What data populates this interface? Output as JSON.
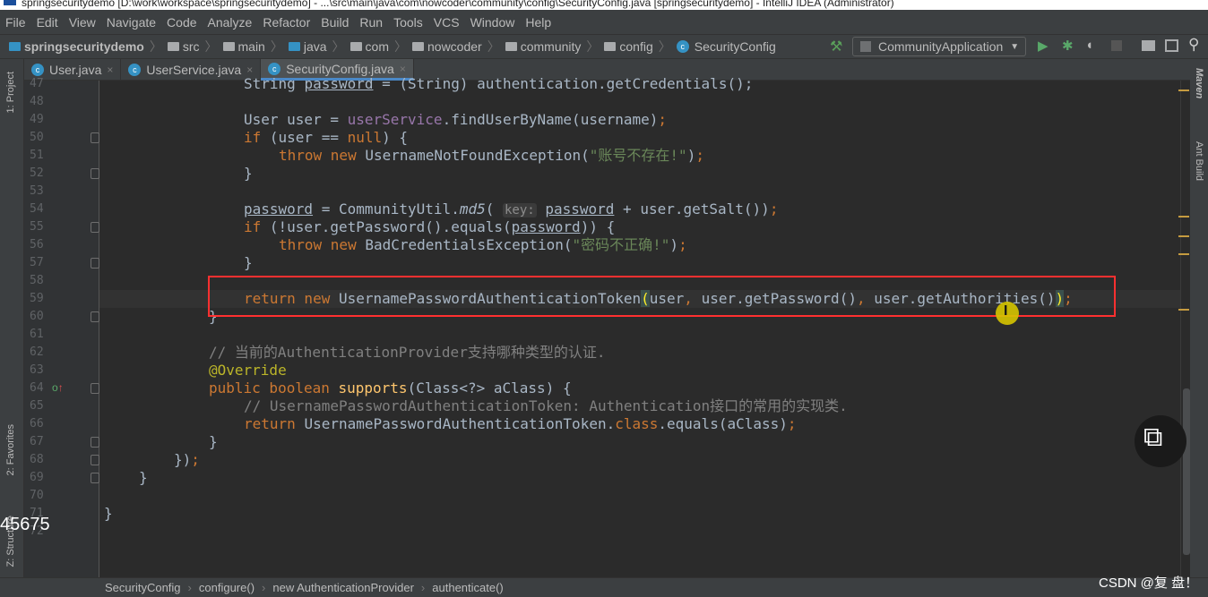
{
  "window": {
    "title": "springsecuritydemo [D:\\work\\workspace\\springsecuritydemo] - ...\\src\\main\\java\\com\\nowcoder\\community\\config\\SecurityConfig.java [springsecuritydemo] - IntelliJ IDEA (Administrator)"
  },
  "menu": [
    "File",
    "Edit",
    "View",
    "Navigate",
    "Code",
    "Analyze",
    "Refactor",
    "Build",
    "Run",
    "Tools",
    "VCS",
    "Window",
    "Help"
  ],
  "breadcrumb": [
    "springsecuritydemo",
    "src",
    "main",
    "java",
    "com",
    "nowcoder",
    "community",
    "config",
    "SecurityConfig"
  ],
  "toolbar": {
    "run_config": "CommunityApplication"
  },
  "tabs": [
    {
      "label": "User.java",
      "active": false
    },
    {
      "label": "UserService.java",
      "active": false
    },
    {
      "label": "SecurityConfig.java",
      "active": true
    }
  ],
  "left_tools": {
    "project": "1: Project",
    "favorites": "2: Favorites",
    "structure": "Z: Structure"
  },
  "right_tools": {
    "maven": "Maven",
    "ant": "Ant Build"
  },
  "code": [
    {
      "n": 47,
      "indent": 4,
      "tokens": [
        [
          "String ",
          ""
        ],
        [
          "password",
          "t-ul"
        ],
        [
          " = (String) authentication.getCredentials();",
          ""
        ]
      ]
    },
    {
      "n": 48,
      "indent": 0,
      "tokens": []
    },
    {
      "n": 49,
      "indent": 4,
      "tokens": [
        [
          "User user = ",
          ""
        ],
        [
          "userService",
          "t-field"
        ],
        [
          ".findUserByName(username)",
          ""
        ],
        [
          ";",
          "t-kw"
        ]
      ]
    },
    {
      "n": 50,
      "indent": 4,
      "tokens": [
        [
          "if",
          "t-kw"
        ],
        [
          " (user == ",
          ""
        ],
        [
          "null",
          "t-kw"
        ],
        [
          ") {",
          ""
        ]
      ],
      "fold": true
    },
    {
      "n": 51,
      "indent": 5,
      "tokens": [
        [
          "throw new ",
          "t-kw"
        ],
        [
          "UsernameNotFoundException(",
          ""
        ],
        [
          "\"账号不存在!\"",
          "t-str"
        ],
        [
          ")",
          ""
        ],
        [
          ";",
          "t-kw"
        ]
      ]
    },
    {
      "n": 52,
      "indent": 4,
      "tokens": [
        [
          "}",
          ""
        ]
      ],
      "fold": true
    },
    {
      "n": 53,
      "indent": 0,
      "tokens": []
    },
    {
      "n": 54,
      "indent": 4,
      "tokens": [
        [
          "password",
          "t-ul"
        ],
        [
          " = CommunityUtil.",
          ""
        ],
        [
          "md5",
          "t-it"
        ],
        [
          "( ",
          ""
        ],
        [
          "key:",
          "t-hint"
        ],
        [
          " ",
          ""
        ],
        [
          "password",
          "t-ul"
        ],
        [
          " + user.getSalt())",
          ""
        ],
        [
          ";",
          "t-kw"
        ]
      ]
    },
    {
      "n": 55,
      "indent": 4,
      "tokens": [
        [
          "if",
          "t-kw"
        ],
        [
          " (!user.getPassword().equals(",
          ""
        ],
        [
          "password",
          "t-ul"
        ],
        [
          ")) {",
          ""
        ]
      ],
      "fold": true
    },
    {
      "n": 56,
      "indent": 5,
      "tokens": [
        [
          "throw new ",
          "t-kw"
        ],
        [
          "BadCredentialsException(",
          ""
        ],
        [
          "\"密码不正确!\"",
          "t-str"
        ],
        [
          ")",
          ""
        ],
        [
          ";",
          "t-kw"
        ]
      ]
    },
    {
      "n": 57,
      "indent": 4,
      "tokens": [
        [
          "}",
          ""
        ]
      ],
      "fold": true
    },
    {
      "n": 58,
      "indent": 0,
      "tokens": []
    },
    {
      "n": 59,
      "indent": 4,
      "tokens": [
        [
          "return new ",
          "t-kw"
        ],
        [
          "UsernamePasswordAuthenticationToken",
          ""
        ],
        [
          "(",
          "t-brace"
        ],
        [
          "user",
          ""
        ],
        [
          ", ",
          "t-kw"
        ],
        [
          "user.getPassword()",
          ""
        ],
        [
          ", ",
          "t-kw"
        ],
        [
          "user.getAuthorities()",
          ""
        ],
        [
          ")",
          "t-brace"
        ],
        [
          ";",
          "t-kw"
        ]
      ]
    },
    {
      "n": 60,
      "indent": 3,
      "tokens": [
        [
          "}",
          ""
        ]
      ],
      "fold": true
    },
    {
      "n": 61,
      "indent": 0,
      "tokens": []
    },
    {
      "n": 62,
      "indent": 3,
      "tokens": [
        [
          "// 当前的AuthenticationProvider支持哪种类型的认证.",
          "t-cm"
        ]
      ]
    },
    {
      "n": 63,
      "indent": 3,
      "tokens": [
        [
          "@Override",
          "t-ann"
        ]
      ]
    },
    {
      "n": 64,
      "indent": 3,
      "tokens": [
        [
          "public boolean ",
          "t-kw"
        ],
        [
          "supports",
          "t-decl"
        ],
        [
          "(Class<?> aClass) {",
          ""
        ]
      ],
      "fold": true
    },
    {
      "n": 65,
      "indent": 4,
      "tokens": [
        [
          "// UsernamePasswordAuthenticationToken: Authentication接口的常用的实现类.",
          "t-cm"
        ]
      ]
    },
    {
      "n": 66,
      "indent": 4,
      "tokens": [
        [
          "return ",
          "t-kw"
        ],
        [
          "UsernamePasswordAuthenticationToken.",
          ""
        ],
        [
          "class",
          "t-kw"
        ],
        [
          ".equals(aClass)",
          ""
        ],
        [
          ";",
          "t-kw"
        ]
      ]
    },
    {
      "n": 67,
      "indent": 3,
      "tokens": [
        [
          "}",
          ""
        ]
      ],
      "fold": true
    },
    {
      "n": 68,
      "indent": 2,
      "tokens": [
        [
          "})",
          ""
        ],
        [
          ";",
          "t-kw"
        ]
      ],
      "fold": true
    },
    {
      "n": 69,
      "indent": 1,
      "tokens": [
        [
          "}",
          ""
        ]
      ],
      "fold": true
    },
    {
      "n": 70,
      "indent": 0,
      "tokens": []
    },
    {
      "n": 71,
      "indent": 0,
      "tokens": [
        [
          "}",
          ""
        ]
      ]
    },
    {
      "n": 72,
      "indent": 0,
      "tokens": []
    }
  ],
  "overlay_number": "45675",
  "status_breadcrumb": [
    "SecurityConfig",
    "configure()",
    "new AuthenticationProvider",
    "authenticate()"
  ],
  "watermark": "CSDN @复 盘！",
  "colors": {
    "keyword": "#cc7832",
    "string": "#6a8759",
    "field": "#9876aa",
    "comment": "#808080",
    "annotation": "#bbb529",
    "highlight_box": "#ff3030"
  }
}
